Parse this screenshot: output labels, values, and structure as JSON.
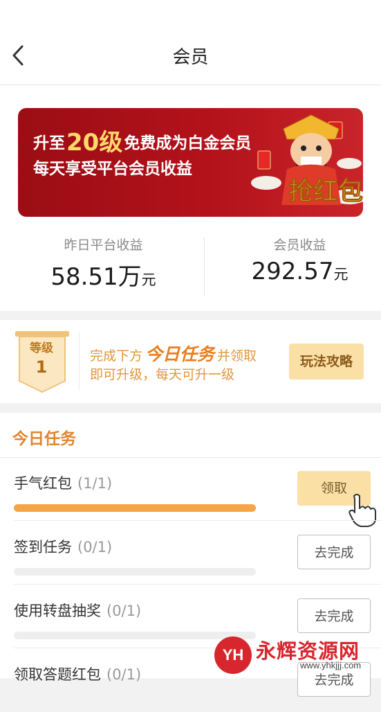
{
  "header": {
    "title": "会员",
    "back_icon": "chevron-left-icon"
  },
  "banner": {
    "line1_prefix": "升至",
    "line1_highlight": "20级",
    "line1_suffix": "免费成为白金会员",
    "line2": "每天享受平台会员收益",
    "art_text": "抢红包",
    "colors": {
      "background": "#b3121b",
      "highlight": "#ffd86a"
    }
  },
  "stats": {
    "platform": {
      "label": "昨日平台收益",
      "value": "58.51万",
      "unit": "元"
    },
    "member": {
      "label": "会员收益",
      "value": "292.57",
      "unit": "元"
    }
  },
  "level": {
    "label": "等级",
    "number": "1",
    "desc_prefix": "完成下方",
    "desc_highlight": "今日任务",
    "desc_suffix": "并领取",
    "desc_line2": "即可升级，每天可升一级",
    "guide_button": "玩法攻略"
  },
  "tasks": {
    "title": "今日任务",
    "items": [
      {
        "name": "手气红包",
        "count": "(1/1)",
        "progress": 1.0,
        "button": "领取",
        "state": "claim"
      },
      {
        "name": "签到任务",
        "count": "(0/1)",
        "progress": 0.0,
        "button": "去完成",
        "state": "todo"
      },
      {
        "name": "使用转盘抽奖",
        "count": "(0/1)",
        "progress": 0.0,
        "button": "去完成",
        "state": "todo"
      },
      {
        "name": "领取答题红包",
        "count": "(0/1)",
        "progress": 0.0,
        "button": "去完成",
        "state": "todo"
      }
    ]
  },
  "watermark": {
    "logo": "YH",
    "name": "永辉资源网",
    "url": "www.yhkjjj.com"
  },
  "colors": {
    "accent": "#e0842e",
    "progress_fill": "#f5a446",
    "claim_button": "#fbe0a6"
  }
}
